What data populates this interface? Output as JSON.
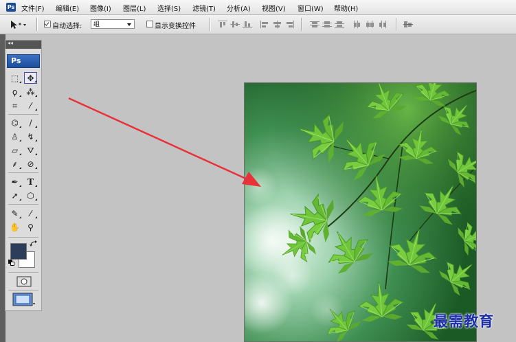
{
  "app": {
    "badge": "Ps"
  },
  "menubar": {
    "items": [
      {
        "label": "文件(F)"
      },
      {
        "label": "编辑(E)"
      },
      {
        "label": "图像(I)"
      },
      {
        "label": "图层(L)"
      },
      {
        "label": "选择(S)"
      },
      {
        "label": "滤镜(T)"
      },
      {
        "label": "分析(A)"
      },
      {
        "label": "视图(V)"
      },
      {
        "label": "窗口(W)"
      },
      {
        "label": "帮助(H)"
      }
    ]
  },
  "options": {
    "auto_select": {
      "label": "自动选择:",
      "checked": true
    },
    "auto_select_target": {
      "value": "组"
    },
    "show_transform": {
      "label": "显示变换控件",
      "checked": false
    }
  },
  "toolbox": {
    "collapse": "◂◂",
    "logo": "Ps",
    "tools": [
      {
        "name": "marquee-tool-icon",
        "glyph": "⬚"
      },
      {
        "name": "move-tool-icon",
        "glyph": "✥",
        "selected": true
      },
      {
        "name": "lasso-tool-icon",
        "glyph": "ϙ"
      },
      {
        "name": "magic-wand-tool-icon",
        "glyph": "⁂"
      },
      {
        "name": "crop-tool-icon",
        "glyph": "⌗"
      },
      {
        "name": "eyedropper-slice-tool-icon",
        "glyph": "⁄"
      },
      {
        "name": "healing-brush-tool-icon",
        "glyph": "⌬"
      },
      {
        "name": "brush-tool-icon",
        "glyph": "∕"
      },
      {
        "name": "clone-stamp-tool-icon",
        "glyph": "♙"
      },
      {
        "name": "history-brush-tool-icon",
        "glyph": "↯"
      },
      {
        "name": "eraser-tool-icon",
        "glyph": "▱"
      },
      {
        "name": "paint-bucket-tool-icon",
        "glyph": "⛛"
      },
      {
        "name": "blur-tool-icon",
        "glyph": "⸙"
      },
      {
        "name": "dodge-tool-icon",
        "glyph": "⊘"
      },
      {
        "name": "pen-tool-icon",
        "glyph": "✒"
      },
      {
        "name": "type-tool-icon",
        "glyph": "T"
      },
      {
        "name": "path-selection-tool-icon",
        "glyph": "➚"
      },
      {
        "name": "shape-tool-icon",
        "glyph": "⬡"
      },
      {
        "name": "notes-tool-icon",
        "glyph": "✎"
      },
      {
        "name": "eyedropper-tool-icon",
        "glyph": "⁄"
      },
      {
        "name": "hand-tool-icon",
        "glyph": "✋"
      },
      {
        "name": "zoom-tool-icon",
        "glyph": "⚲"
      }
    ],
    "colors": {
      "foreground": "#2c3e5a",
      "background": "#ffffff"
    }
  },
  "overlay": {
    "watermark": "最需教育",
    "arrow_color": "#e8323a"
  }
}
